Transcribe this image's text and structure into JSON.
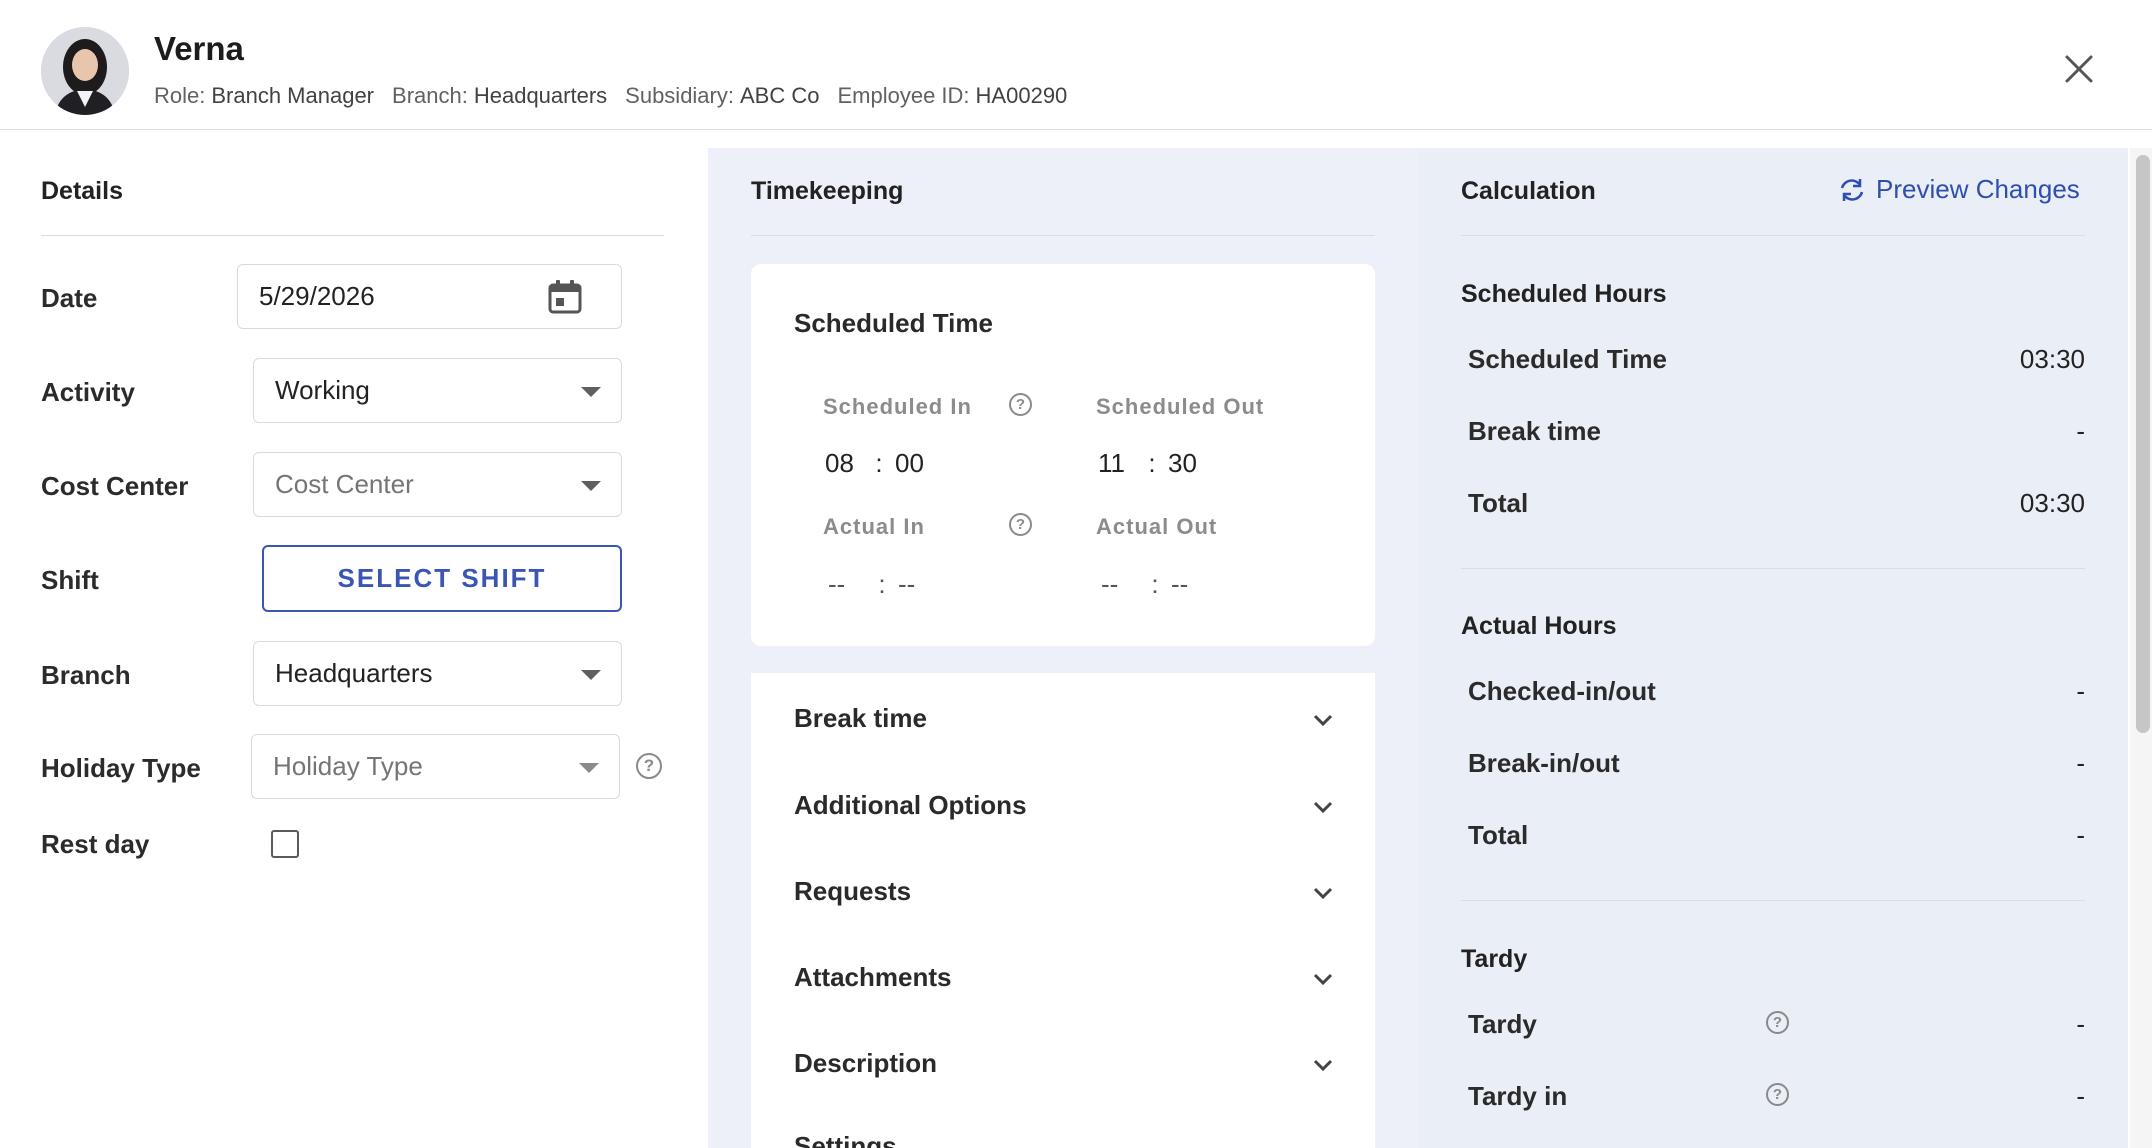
{
  "header": {
    "name": "Verna",
    "role_label": "Role:",
    "role_value": "Branch Manager",
    "branch_label": "Branch:",
    "branch_value": "Headquarters",
    "subsidiary_label": "Subsidiary:",
    "subsidiary_value": "ABC Co",
    "employee_id_label": "Employee ID:",
    "employee_id_value": "HA00290"
  },
  "details": {
    "title": "Details",
    "date_label": "Date",
    "date_value": "5/29/2026",
    "activity_label": "Activity",
    "activity_value": "Working",
    "cost_center_label": "Cost Center",
    "cost_center_placeholder": "Cost Center",
    "shift_label": "Shift",
    "select_shift_button": "SELECT SHIFT",
    "branch_label": "Branch",
    "branch_value": "Headquarters",
    "holiday_type_label": "Holiday Type",
    "holiday_type_placeholder": "Holiday Type",
    "rest_day_label": "Rest day",
    "rest_day_checked": false
  },
  "timekeeping": {
    "title": "Timekeeping",
    "card_title": "Scheduled Time",
    "scheduled_in_label": "Scheduled In",
    "scheduled_in_hour": "08",
    "scheduled_in_minute": "00",
    "scheduled_out_label": "Scheduled Out",
    "scheduled_out_hour": "11",
    "scheduled_out_minute": "30",
    "actual_in_label": "Actual In",
    "actual_in_hour": "--",
    "actual_in_minute": "--",
    "actual_out_label": "Actual Out",
    "actual_out_hour": "--",
    "actual_out_minute": "--",
    "separator": ":",
    "sections": [
      "Break time",
      "Additional Options",
      "Requests",
      "Attachments",
      "Description",
      "Settings"
    ]
  },
  "calculation": {
    "title": "Calculation",
    "preview_label": "Preview Changes",
    "scheduled_hours_title": "Scheduled Hours",
    "scheduled_rows": [
      {
        "label": "Scheduled Time",
        "value": "03:30"
      },
      {
        "label": "Break time",
        "value": "-"
      },
      {
        "label": "Total",
        "value": "03:30"
      }
    ],
    "actual_hours_title": "Actual Hours",
    "actual_rows": [
      {
        "label": "Checked-in/out",
        "value": "-"
      },
      {
        "label": "Break-in/out",
        "value": "-"
      },
      {
        "label": "Total",
        "value": "-"
      }
    ],
    "tardy_title": "Tardy",
    "tardy_rows": [
      {
        "label": "Tardy",
        "value": "-"
      },
      {
        "label": "Tardy in",
        "value": "-"
      }
    ]
  },
  "icons": {
    "help": "?",
    "accent_color": "#3a55b4"
  }
}
